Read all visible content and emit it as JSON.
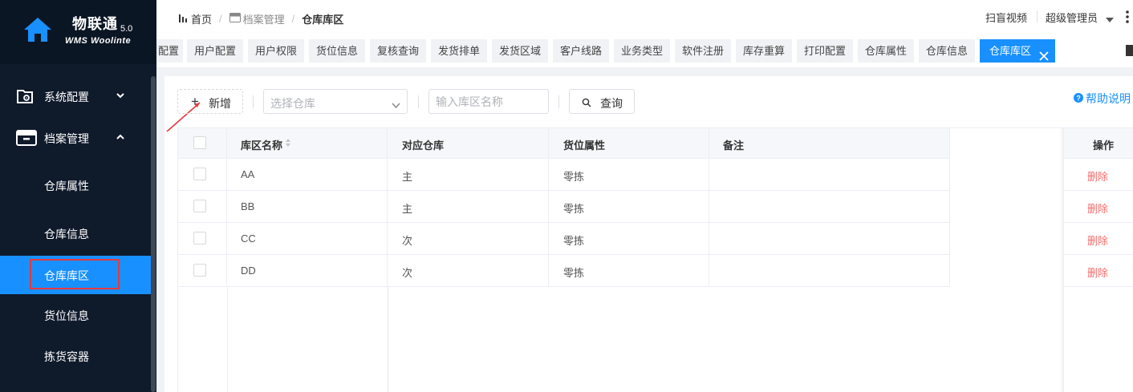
{
  "app": {
    "name": "物联通",
    "version": "5.0",
    "subtitle": "WMS Woolinte"
  },
  "sidebar": {
    "groups": [
      {
        "label": "系统配置",
        "icon": "folder-settings-icon",
        "expanded": false
      },
      {
        "label": "档案管理",
        "icon": "archive-icon",
        "expanded": true
      }
    ],
    "items": [
      {
        "label": "仓库属性",
        "active": false
      },
      {
        "label": "仓库信息",
        "active": false
      },
      {
        "label": "仓库库区",
        "active": true
      },
      {
        "label": "货位信息",
        "active": false
      },
      {
        "label": "拣货容器",
        "active": false
      }
    ]
  },
  "breadcrumb": {
    "home": "首页",
    "section": "档案管理",
    "current": "仓库库区"
  },
  "header": {
    "video_link": "扫盲视频",
    "user": "超级管理员"
  },
  "tabs": [
    {
      "label": "配置"
    },
    {
      "label": "用户配置"
    },
    {
      "label": "用户权限"
    },
    {
      "label": "货位信息"
    },
    {
      "label": "复核查询"
    },
    {
      "label": "发货排单"
    },
    {
      "label": "发货区域"
    },
    {
      "label": "客户线路"
    },
    {
      "label": "业务类型"
    },
    {
      "label": "软件注册"
    },
    {
      "label": "库存重算"
    },
    {
      "label": "打印配置"
    },
    {
      "label": "仓库属性"
    },
    {
      "label": "仓库信息"
    },
    {
      "label": "仓库库区",
      "active": true
    }
  ],
  "toolbar": {
    "add_label": "新增",
    "warehouse_select_placeholder": "选择仓库",
    "zone_name_placeholder": "输入库区名称",
    "query_label": "查询",
    "help_label": "帮助说明"
  },
  "table": {
    "columns": [
      "库区名称",
      "对应仓库",
      "货位属性",
      "备注"
    ],
    "op_column": "操作",
    "rows": [
      {
        "name": "AA",
        "warehouse": "主",
        "attr": "零拣",
        "note": "",
        "op": "删除"
      },
      {
        "name": "BB",
        "warehouse": "主",
        "attr": "零拣",
        "note": "",
        "op": "删除"
      },
      {
        "name": "CC",
        "warehouse": "次",
        "attr": "零拣",
        "note": "",
        "op": "删除"
      },
      {
        "name": "DD",
        "warehouse": "次",
        "attr": "零拣",
        "note": "",
        "op": "删除"
      }
    ]
  },
  "colors": {
    "sidebar_bg": "#0f1a2b",
    "accent": "#1890ff",
    "delete_text": "#f56c6c",
    "annotation_red": "#e8383d"
  }
}
